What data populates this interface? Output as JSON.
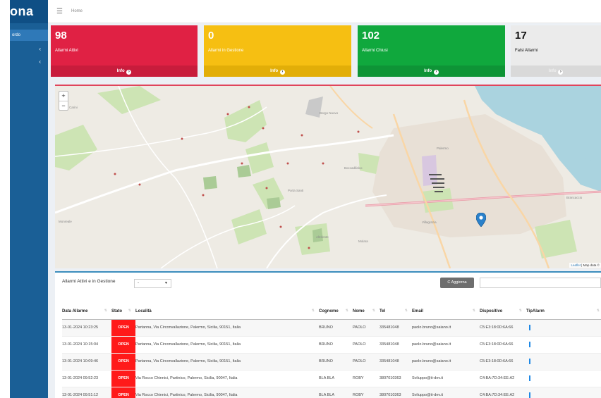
{
  "app": {
    "brand": "ona",
    "breadcrumb": "Home"
  },
  "sidebar": {
    "items": [
      {
        "label": "ordo",
        "active": true
      },
      {
        "label": "",
        "chevron": "‹"
      },
      {
        "label": "",
        "chevron": "‹"
      }
    ]
  },
  "stats": [
    {
      "value": "98",
      "label": "Allarmi Attivi",
      "footer": "Info",
      "color": "#e02144"
    },
    {
      "value": "0",
      "label": "Allarmi in Gestione",
      "footer": "Info",
      "color": "#f6bf12"
    },
    {
      "value": "102",
      "label": "Allarmi Chiusi",
      "footer": "Info",
      "color": "#10a83d"
    },
    {
      "value": "17",
      "label": "Falsi Allarmi",
      "footer": "Info",
      "color": "#ebebeb"
    }
  ],
  "map": {
    "zoom_in": "+",
    "zoom_out": "−",
    "attribution_leaflet": "Leaflet",
    "attribution_rest": "| Map data ©"
  },
  "table_panel": {
    "title": "Allarmi Attivi e in Gestione",
    "select_value": "-",
    "refresh_label": "C Aggiorna",
    "columns": [
      "Data Allarme",
      "Stato",
      "Località",
      "Cognome",
      "Nome",
      "Tel",
      "Email",
      "Dispositivo",
      "TipAlarm"
    ],
    "rows": [
      {
        "date": "13-01-2024 10:23:25",
        "state": "OPEN",
        "location": "Partanna, Via Circonvallazione, Palermo, Sicilia, 90151, Italia",
        "surname": "BRUNO",
        "name": "PAOLO",
        "tel": "335481048",
        "email": "paolo.bruno@saiano.it",
        "device": "C5:E3:18:0D:6A:66"
      },
      {
        "date": "13-01-2024 10:15:04",
        "state": "OPEN",
        "location": "Partanna, Via Circonvallazione, Palermo, Sicilia, 90151, Italia",
        "surname": "BRUNO",
        "name": "PAOLO",
        "tel": "335481048",
        "email": "paolo.bruno@saiano.it",
        "device": "C5:E3:18:0D:6A:66"
      },
      {
        "date": "13-01-2024 10:09:46",
        "state": "OPEN",
        "location": "Partanna, Via Circonvallazione, Palermo, Sicilia, 90151, Italia",
        "surname": "BRUNO",
        "name": "PAOLO",
        "tel": "335481048",
        "email": "paolo.bruno@saiano.it",
        "device": "C5:E3:18:0D:6A:66"
      },
      {
        "date": "13-01-2024 09:52:23",
        "state": "OPEN",
        "location": "Via Rocco Chinnici, Partinico, Palermo, Sicilia, 90047, Italia",
        "surname": "BLA BLA",
        "name": "ROBY",
        "tel": "3807010363",
        "email": "Sviluppo@it-dev.it",
        "device": "C4:BA:7D:34:EE:A2"
      },
      {
        "date": "13-01-2024 09:51:12",
        "state": "OPEN",
        "location": "Via Rocco Chinnici, Partinico, Palermo, Sicilia, 90047, Italia",
        "surname": "BLA BLA",
        "name": "ROBY",
        "tel": "3807010363",
        "email": "Sviluppo@it-dev.it",
        "device": "C4:BA:7D:34:EE:A2"
      }
    ]
  }
}
